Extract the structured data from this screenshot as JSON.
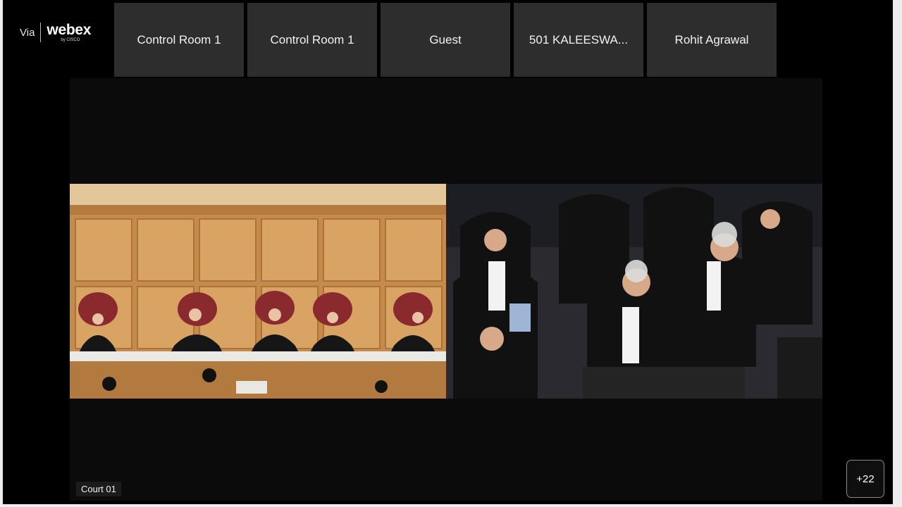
{
  "brand": {
    "via": "Via",
    "logo": "webex",
    "sub": "by CISCO"
  },
  "participants": [
    {
      "name": "Control Room 1"
    },
    {
      "name": "Control Room 1"
    },
    {
      "name": "Guest"
    },
    {
      "name": "501 KALEESWA..."
    },
    {
      "name": "Rohit Agrawal"
    }
  ],
  "stage": {
    "label": "Court 01"
  },
  "overflow": {
    "label": "+22"
  },
  "colors": {
    "background": "#000000",
    "tile": "#2d2d2d",
    "panel": "#c9904e",
    "robe": "#141414"
  }
}
